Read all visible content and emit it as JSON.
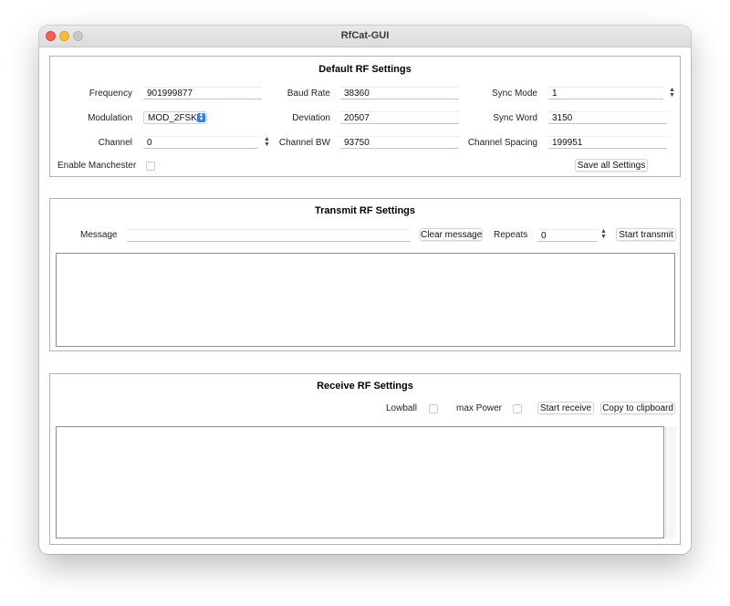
{
  "window": {
    "title": "RfCat-GUI",
    "traffic_lights": [
      "close",
      "minimize",
      "maximize"
    ]
  },
  "default_rf": {
    "title": "Default RF Settings",
    "frequency_label": "Frequency",
    "frequency_value": "901999877",
    "baud_rate_label": "Baud Rate",
    "baud_rate_value": "38360",
    "sync_mode_label": "Sync Mode",
    "sync_mode_value": "1",
    "modulation_label": "Modulation",
    "modulation_value": "MOD_2FSK",
    "deviation_label": "Deviation",
    "deviation_value": "20507",
    "sync_word_label": "Sync Word",
    "sync_word_value": "3150",
    "channel_label": "Channel",
    "channel_value": "0",
    "channel_bw_label": "Channel BW",
    "channel_bw_value": "93750",
    "channel_spacing_label": "Channel Spacing",
    "channel_spacing_value": "199951",
    "manchester_label": "Enable Manchester",
    "manchester_checked": false,
    "save_button": "Save all Settings"
  },
  "transmit_rf": {
    "title": "Transmit RF Settings",
    "message_label": "Message",
    "message_value": "",
    "clear_button": "Clear message",
    "repeats_label": "Repeats",
    "repeats_value": "0",
    "start_button": "Start transmit",
    "output": ""
  },
  "receive_rf": {
    "title": "Receive RF Settings",
    "lowball_label": "Lowball",
    "lowball_checked": false,
    "max_power_label": "max Power",
    "max_power_checked": false,
    "start_button": "Start receive",
    "copy_button": "Copy to clipboard",
    "output": ""
  },
  "colors": {
    "window_background": "#ececec",
    "content_background": "#ffffff",
    "accent": "#2f7cf6",
    "close": "#ff5f57",
    "minimize": "#febc2e",
    "maximize_inactive": "#c8c8c8"
  },
  "icons": [
    "close-icon",
    "minimize-icon",
    "maximize-icon",
    "spinner-arrows-icon",
    "combo-arrows-icon"
  ]
}
